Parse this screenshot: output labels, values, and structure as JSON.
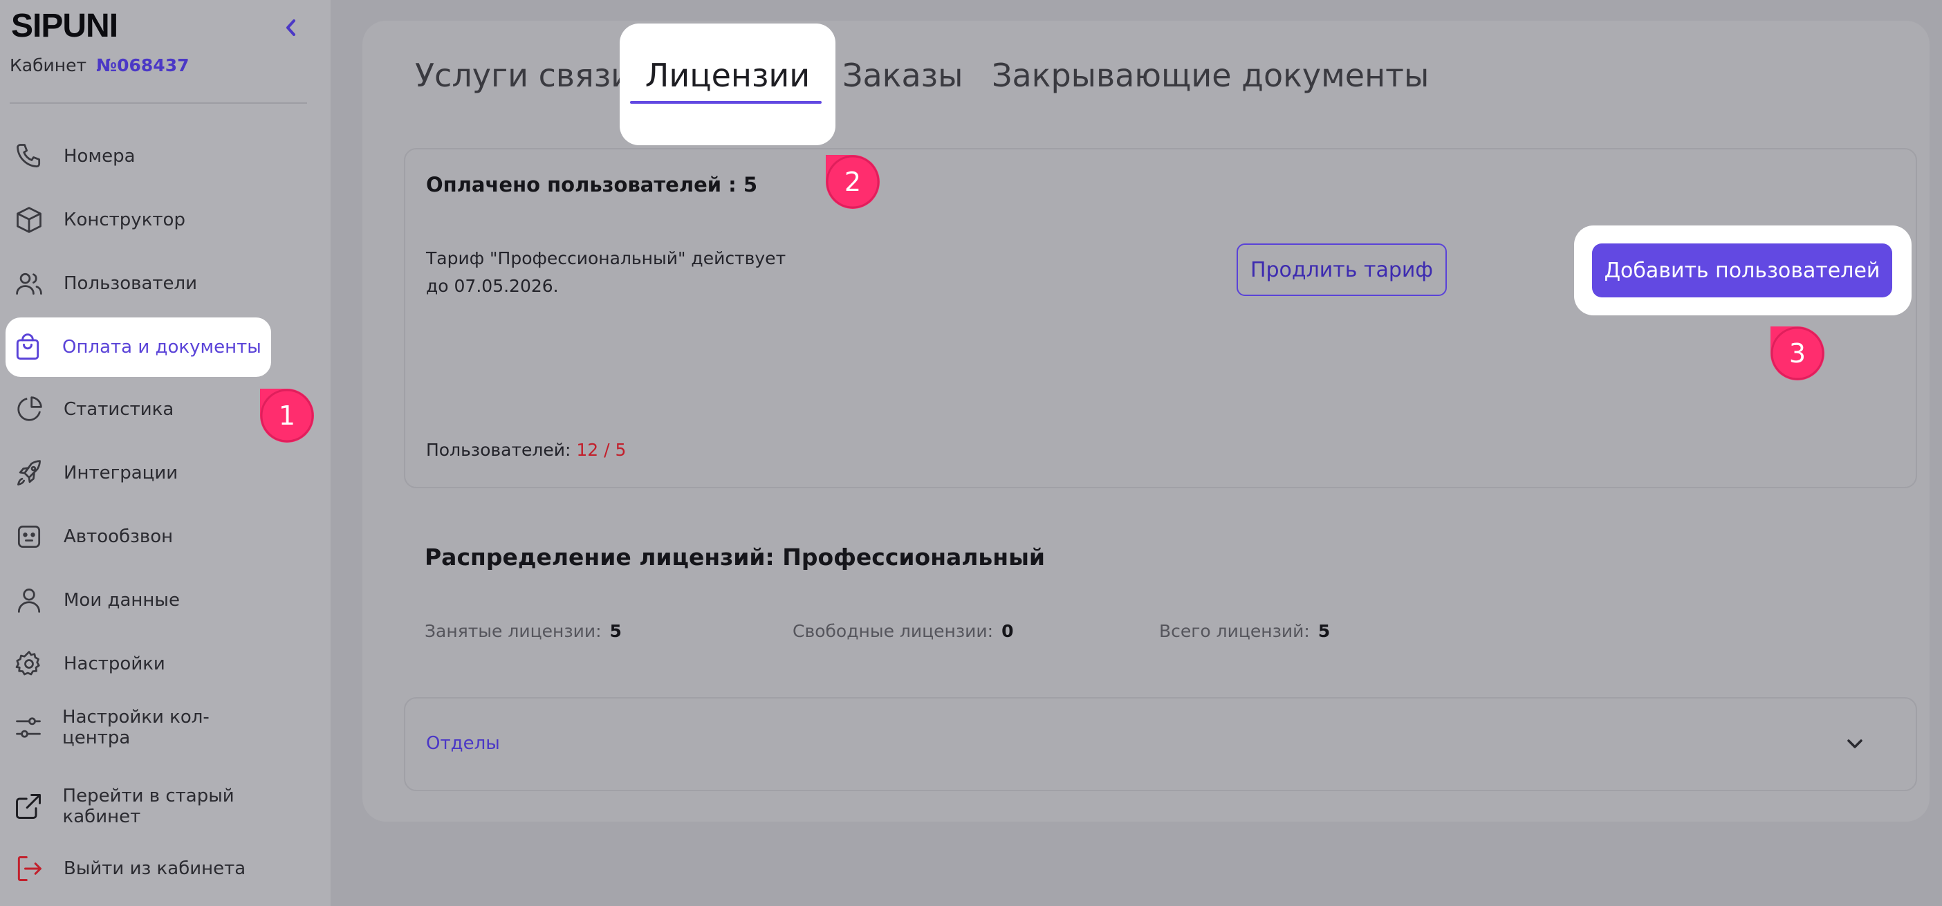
{
  "sidebar": {
    "logo": "SIPUNI",
    "cabinet_label": "Кабинет",
    "cabinet_number": "№068437",
    "items": [
      {
        "label": "Номера",
        "icon": "phone-icon"
      },
      {
        "label": "Конструктор",
        "icon": "cube-icon"
      },
      {
        "label": "Пользователи",
        "icon": "users-icon"
      },
      {
        "label": "Оплата и документы",
        "icon": "shopping-bag-icon",
        "active": true
      },
      {
        "label": "Статистика",
        "icon": "pie-chart-icon"
      },
      {
        "label": "Интеграции",
        "icon": "rocket-icon"
      },
      {
        "label": "Автообзвон",
        "icon": "robot-icon"
      },
      {
        "label": "Мои данные",
        "icon": "user-icon"
      },
      {
        "label": "Настройки",
        "icon": "gear-icon"
      },
      {
        "label": "Настройки кол-центра",
        "icon": "sliders-icon"
      }
    ],
    "bottom_items": [
      {
        "label": "Перейти в старый кабинет",
        "icon": "external-link-icon"
      },
      {
        "label": "Выйти из кабинета",
        "icon": "logout-icon"
      }
    ]
  },
  "tabs": [
    {
      "label": "Услуги связи"
    },
    {
      "label": "Лицензии",
      "active": true
    },
    {
      "label": "Заказы"
    },
    {
      "label": "Закрывающие документы"
    }
  ],
  "license_card": {
    "paid_users_label": "Оплачено пользователей : 5",
    "tariff_line1": "Тариф \"Профессиональный\" действует",
    "tariff_line2": "до 07.05.2026.",
    "extend_button": "Продлить тариф",
    "add_users_button": "Добавить пользователей",
    "users_label": "Пользователей:",
    "users_value": "12 / 5"
  },
  "distribution": {
    "title": "Распределение лицензий: Профессиональный",
    "occupied_label": "Занятые лицензии:",
    "occupied_value": "5",
    "free_label": "Свободные лицензии:",
    "free_value": "0",
    "total_label": "Всего лицензий:",
    "total_value": "5"
  },
  "departments": {
    "label": "Отделы"
  },
  "callouts": [
    "1",
    "2",
    "3"
  ],
  "colors": {
    "accent": "#6249e2",
    "accent_text": "#5a43d8",
    "callout": "#ff2d6e",
    "warning": "#c2202c"
  }
}
